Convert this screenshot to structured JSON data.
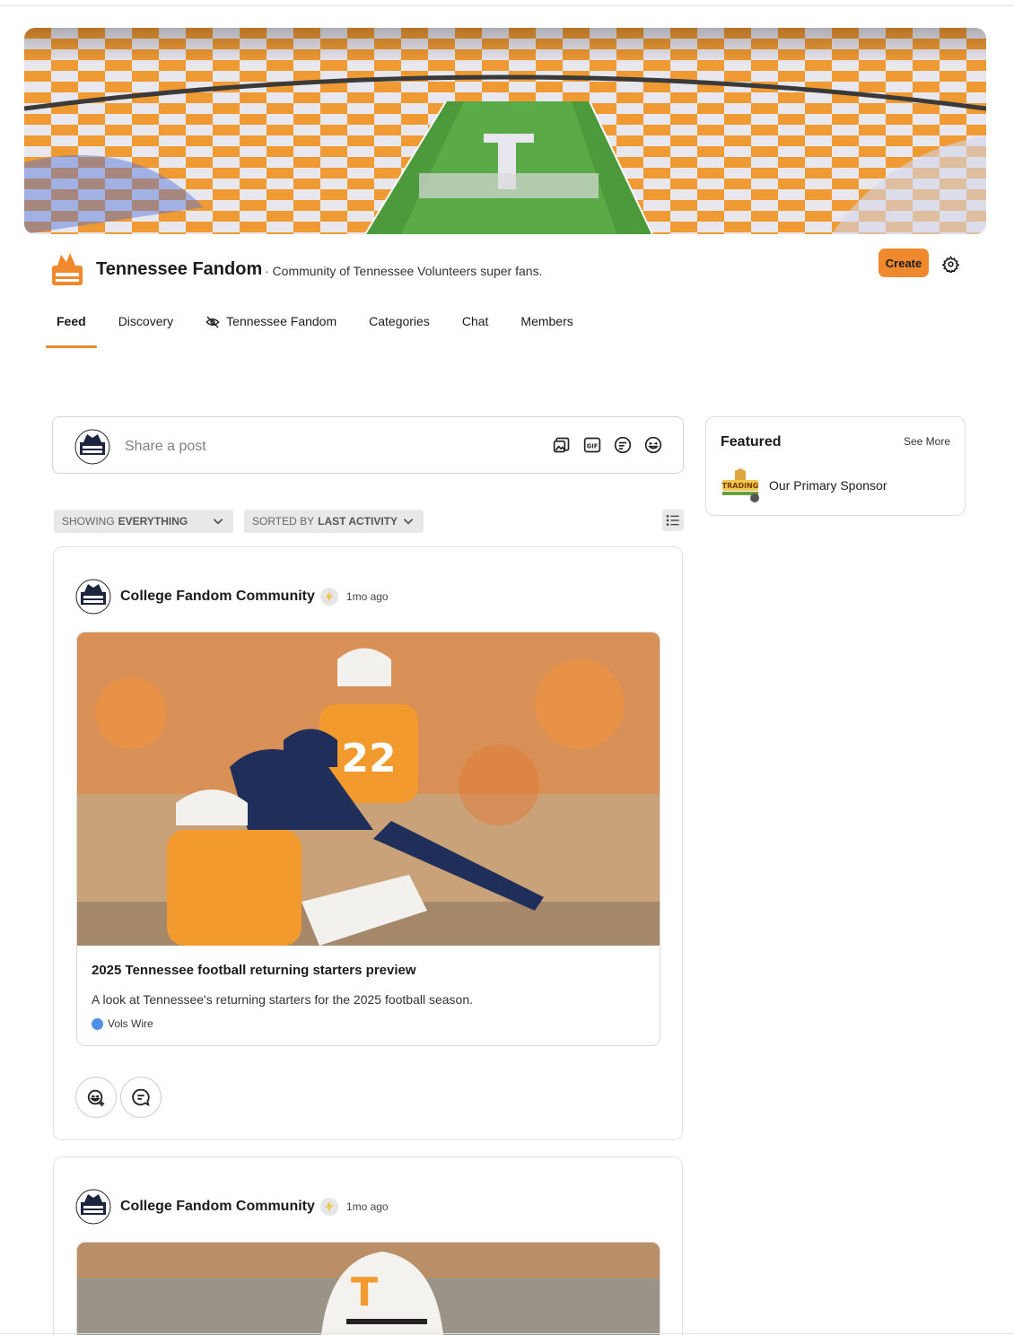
{
  "community": {
    "name": "Tennessee Fandom",
    "description": "· Community of Tennessee Volunteers super fans.",
    "create_label": "Create"
  },
  "tabs": [
    {
      "label": "Feed",
      "active": true
    },
    {
      "label": "Discovery"
    },
    {
      "label": "Tennessee Fandom",
      "icon": "eye-slash-icon"
    },
    {
      "label": "Categories"
    },
    {
      "label": "Chat"
    },
    {
      "label": "Members"
    }
  ],
  "composer": {
    "placeholder": "Share a post",
    "tools": [
      "image-icon",
      "gif-icon",
      "poll-icon",
      "emoji-icon"
    ]
  },
  "filters": {
    "show_prefix": "SHOWING",
    "show_value": "EVERYTHING",
    "sort_prefix": "SORTED BY",
    "sort_value": "LAST ACTIVITY"
  },
  "featured": {
    "title": "Featured",
    "see_more": "See More",
    "sponsor_name": "Our Primary Sponsor"
  },
  "posts": [
    {
      "author": "College Fandom Community",
      "time": "1mo ago",
      "link_title": "2025 Tennessee football returning starters preview",
      "link_desc": "A look at Tennessee's returning starters for the 2025 football season.",
      "source": "Vols Wire"
    },
    {
      "author": "College Fandom Community",
      "time": "1mo ago"
    }
  ],
  "colors": {
    "accent": "#f0882e",
    "border": "#d6d6d6"
  }
}
